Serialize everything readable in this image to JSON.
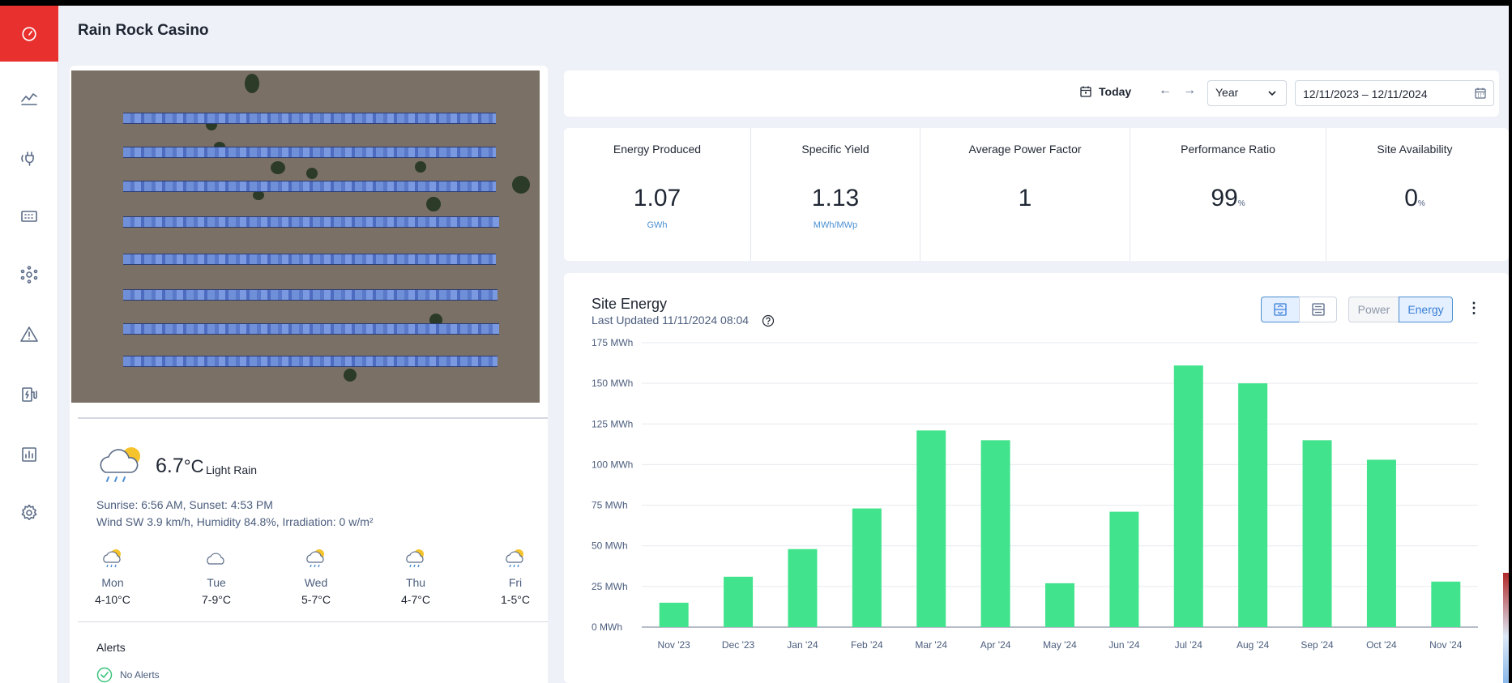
{
  "header": {
    "site_name": "Rain Rock Casino"
  },
  "sidebar": {
    "items": [
      "dashboard-icon",
      "trend-chart-icon",
      "plug-icon",
      "panel-grid-icon",
      "network-icon",
      "warning-icon",
      "charger-icon",
      "report-icon",
      "gear-icon"
    ]
  },
  "weather": {
    "temperature": "6.7",
    "unit": "°C",
    "condition": "Light Rain",
    "sun": "Sunrise: 6:56 AM, Sunset: 4:53 PM",
    "details": "Wind SW 3.9 km/h, Humidity 84.8%, Irradiation: 0 w/m²",
    "forecast": [
      {
        "day": "Mon",
        "range": "4-10°C",
        "icon": "sun-rain-icon"
      },
      {
        "day": "Tue",
        "range": "7-9°C",
        "icon": "cloud-icon"
      },
      {
        "day": "Wed",
        "range": "5-7°C",
        "icon": "sun-rain-icon"
      },
      {
        "day": "Thu",
        "range": "4-7°C",
        "icon": "sun-rain-icon"
      },
      {
        "day": "Fri",
        "range": "1-5°C",
        "icon": "sun-rain-icon"
      }
    ]
  },
  "alerts": {
    "title": "Alerts",
    "status": "No Alerts"
  },
  "toolbar": {
    "today_label": "Today",
    "period": "Year",
    "date_range": "12/11/2023 – 12/11/2024"
  },
  "kpis": [
    {
      "label": "Energy Produced",
      "value": "1.07",
      "unit": "GWh",
      "suffix": ""
    },
    {
      "label": "Specific Yield",
      "value": "1.13",
      "unit": "MWh/MWp",
      "suffix": ""
    },
    {
      "label": "Average Power Factor",
      "value": "1",
      "unit": "",
      "suffix": ""
    },
    {
      "label": "Performance Ratio",
      "value": "99",
      "unit": "",
      "suffix": "%"
    },
    {
      "label": "Site Availability",
      "value": "0",
      "unit": "",
      "suffix": "%"
    }
  ],
  "chart_card": {
    "title": "Site Energy",
    "updated": "Last Updated 11/11/2024 08:04",
    "power_label": "Power",
    "energy_label": "Energy"
  },
  "colors": {
    "accent": "#e8302f",
    "bar": "#41e38d",
    "link": "#4b8fd1"
  },
  "chart_data": {
    "type": "bar",
    "title": "Site Energy",
    "categories": [
      "Nov '23",
      "Dec '23",
      "Jan '24",
      "Feb '24",
      "Mar '24",
      "Apr '24",
      "May '24",
      "Jun '24",
      "Jul '24",
      "Aug '24",
      "Sep '24",
      "Oct '24",
      "Nov '24"
    ],
    "values": [
      15,
      31,
      48,
      73,
      121,
      115,
      27,
      71,
      161,
      150,
      115,
      103,
      28
    ],
    "ylim": [
      0,
      175
    ],
    "yticks": [
      0,
      25,
      50,
      75,
      100,
      125,
      150,
      175
    ],
    "ytick_labels": [
      "0 MWh",
      "25 MWh",
      "50 MWh",
      "75 MWh",
      "100 MWh",
      "125 MWh",
      "150 MWh",
      "175 MWh"
    ],
    "grid": true
  }
}
